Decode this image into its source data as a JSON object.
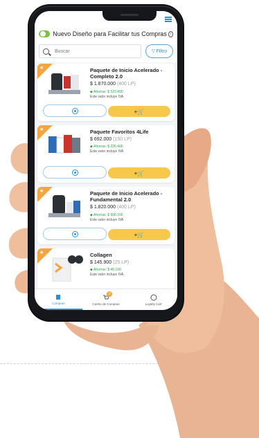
{
  "header": {
    "title": "Nuevo Diseño para Facilitar tus Compras"
  },
  "search": {
    "placeholder": "Buscar",
    "filter_label": "Filtro"
  },
  "products": [
    {
      "name": "Paquete de Inicio Acelerado - Completo 2.0",
      "price": "$ 1.870.000",
      "lp": "(400 LP)",
      "savings": "Ahorras: $ 523.400",
      "iva": "Este valor incluye IVA"
    },
    {
      "name": "Paquete Favoritos 4Life",
      "price": "$ 692.000",
      "lp": "(150 LP)",
      "savings": "Ahorras: $ 226.400",
      "iva": "Este valor incluye IVA"
    },
    {
      "name": "Paquete de Inicio Acelerado - Fundamental 2.0",
      "price": "$ 1.820.000",
      "lp": "(400 LP)",
      "savings": "Ahorras: $ 606.700",
      "iva": "Este valor incluye IVA"
    },
    {
      "name": "Collagen",
      "price": "$ 145.900",
      "lp": "(25 LP)",
      "savings": "Ahorras: $ 46.100",
      "iva": "Este valor incluye IVA"
    }
  ],
  "nav": {
    "items": [
      "Compras",
      "Carrito de Compras",
      "Loyalty Cart"
    ],
    "cart_badge": "0"
  },
  "colors": {
    "accent": "#2d8fd6",
    "cta": "#f7c84c",
    "ribbon": "#f2a541",
    "savings": "#2aa449"
  }
}
